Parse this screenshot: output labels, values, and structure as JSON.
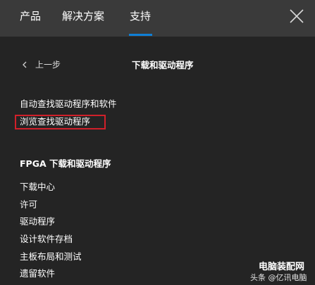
{
  "nav": {
    "tabs": [
      {
        "label": "产品"
      },
      {
        "label": "解决方案"
      },
      {
        "label": "支持"
      }
    ],
    "active_tab": "支持",
    "accent_color": "#0f7fd6"
  },
  "sub_header": {
    "back_label": "上一步",
    "title": "下载和驱动程序"
  },
  "links": [
    {
      "label": "自动查找驱动程序和软件"
    },
    {
      "label": "浏览查找驱动程序",
      "highlighted": true
    }
  ],
  "highlight_color": "#d0202a",
  "section": {
    "title": "FPGA 下载和驱动程序",
    "items": [
      {
        "label": "下载中心"
      },
      {
        "label": "许可"
      },
      {
        "label": "驱动程序"
      },
      {
        "label": "设计软件存档"
      },
      {
        "label": "主板布局和测试"
      },
      {
        "label": "遗留软件"
      }
    ]
  },
  "watermark": {
    "line1": "电脑装配网",
    "line2": "头条 @亿讯电脑"
  }
}
